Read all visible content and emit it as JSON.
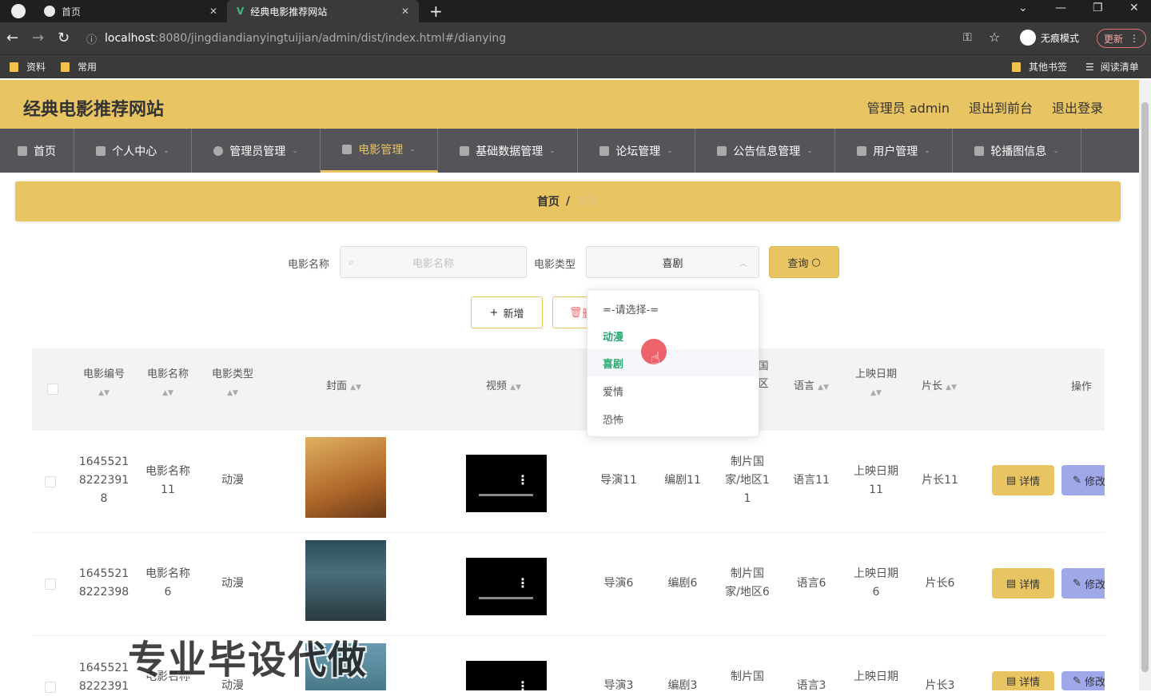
{
  "browser": {
    "tabs": [
      {
        "title": "首页"
      },
      {
        "title": "经典电影推荐网站"
      }
    ],
    "url_host": "localhost",
    "url_path": ":8080/jingdiandianyingtuijian/admin/dist/index.html#/dianying",
    "incognito_label": "无痕模式",
    "update_label": "更新",
    "bookmarks": [
      "资料",
      "常用"
    ],
    "other_bookmarks": "其他书签",
    "reading_list": "阅读清单"
  },
  "header": {
    "title": "经典电影推荐网站",
    "admin_label": "管理员 admin",
    "front_label": "退出到前台",
    "logout_label": "退出登录"
  },
  "nav": [
    {
      "label": "首页"
    },
    {
      "label": "个人中心"
    },
    {
      "label": "管理员管理"
    },
    {
      "label": "电影管理"
    },
    {
      "label": "基础数据管理"
    },
    {
      "label": "论坛管理"
    },
    {
      "label": "公告信息管理"
    },
    {
      "label": "用户管理"
    },
    {
      "label": "轮播图信息"
    }
  ],
  "breadcrumb": {
    "home": "首页",
    "sep": "/",
    "current": "电影"
  },
  "search": {
    "name_label": "电影名称",
    "name_placeholder": "电影名称",
    "type_label": "电影类型",
    "type_value": "喜剧",
    "query_label": "查询"
  },
  "actions": {
    "add_label": "新增",
    "delete_label": "删"
  },
  "dropdown": {
    "options": [
      "=-请选择-=",
      "动漫",
      "喜剧",
      "爱情",
      "恐怖"
    ],
    "selected": "喜剧"
  },
  "table": {
    "headers": {
      "id": [
        "电影编号"
      ],
      "name": "电影名称",
      "type": "电影类型",
      "cover": "封面",
      "video": "视频",
      "region_partial": [
        "国",
        "区"
      ],
      "language": "语言",
      "date": "上映日期",
      "length": "片长",
      "ops": "操作"
    },
    "rows": [
      {
        "id": [
          "1645521",
          "8222391",
          "8"
        ],
        "name": [
          "电影名称",
          "11"
        ],
        "type": "动漫",
        "director": "导演11",
        "writer": "编剧11",
        "region": [
          "制片国",
          "家/地区1",
          "1"
        ],
        "language": "语言11",
        "date": [
          "上映日期",
          "11"
        ],
        "length": "片长11",
        "cover_color": "#c58a3c"
      },
      {
        "id": [
          "1645521",
          "8222398"
        ],
        "name": [
          "电影名称",
          "6"
        ],
        "type": "动漫",
        "director": "导演6",
        "writer": "编剧6",
        "region": [
          "制片国",
          "家/地区6"
        ],
        "language": "语言6",
        "date": [
          "上映日期",
          "6"
        ],
        "length": "片长6",
        "cover_color": "#3b5560"
      },
      {
        "id": [
          "1645521",
          "8222391"
        ],
        "name": [
          "电影名称"
        ],
        "type": "动漫",
        "director": "导演3",
        "writer": "编剧3",
        "region": [
          "制片国"
        ],
        "language": "语言3",
        "date": [
          "上映日期"
        ],
        "length": "片长3",
        "cover_color": "#5b8aa0"
      }
    ],
    "detail_label": "详情",
    "edit_label": "修改"
  },
  "watermark": "专业毕设代做",
  "colors": {
    "accent": "#e8c463",
    "nav_bg": "#555459",
    "selected_option": "#2aa871",
    "edit_btn": "#9fa8e8"
  }
}
